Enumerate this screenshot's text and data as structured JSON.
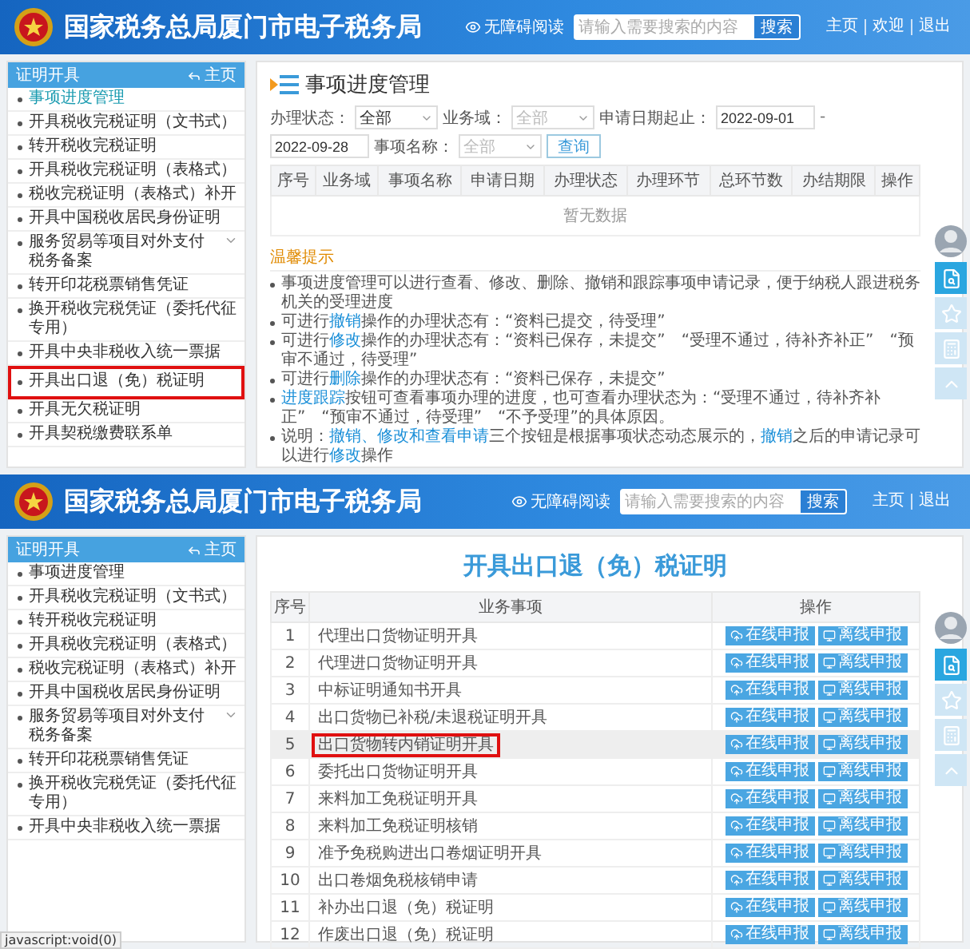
{
  "screens": [
    {
      "kind": "progress",
      "header": {
        "title": "国家税务总局厦门市电子税务局",
        "accessibility": "无障碍阅读",
        "search_placeholder": "请输入需要搜索的内容",
        "search_button": "搜索",
        "links": [
          "主页",
          "欢迎",
          "退出"
        ]
      },
      "sidebar": {
        "title": "证明开具",
        "home": "主页",
        "items": [
          {
            "label": "事项进度管理",
            "selected": true,
            "highlighted": false,
            "expandable": false
          },
          {
            "label": "开具税收完税证明（文书式）",
            "selected": false,
            "highlighted": false,
            "expandable": false
          },
          {
            "label": "转开税收完税证明",
            "selected": false,
            "highlighted": false,
            "expandable": false
          },
          {
            "label": "开具税收完税证明（表格式）",
            "selected": false,
            "highlighted": false,
            "expandable": false
          },
          {
            "label": "税收完税证明（表格式）补开",
            "selected": false,
            "highlighted": false,
            "expandable": false
          },
          {
            "label": "开具中国税收居民身份证明",
            "selected": false,
            "highlighted": false,
            "expandable": false
          },
          {
            "label": "服务贸易等项目对外支付税务备案",
            "selected": false,
            "highlighted": false,
            "expandable": true
          },
          {
            "label": "转开印花税票销售凭证",
            "selected": false,
            "highlighted": false,
            "expandable": false
          },
          {
            "label": "换开税收完税凭证（委托代征专用）",
            "selected": false,
            "highlighted": false,
            "expandable": false
          },
          {
            "label": "开具中央非税收入统一票据",
            "selected": false,
            "highlighted": false,
            "expandable": false
          },
          {
            "label": "开具出口退（免）税证明",
            "selected": false,
            "highlighted": true,
            "expandable": false
          },
          {
            "label": "开具无欠税证明",
            "selected": false,
            "highlighted": false,
            "expandable": false
          },
          {
            "label": "开具契税缴费联系单",
            "selected": false,
            "highlighted": false,
            "expandable": false
          }
        ]
      },
      "page": {
        "title": "事项进度管理",
        "filters": [
          {
            "kind": "select",
            "label": "办理状态：",
            "value": "全部"
          },
          {
            "kind": "select",
            "label": "业务域：",
            "placeholder": "全部"
          },
          {
            "kind": "daterange",
            "label": "申请日期起止：",
            "from": "2022-09-01",
            "separator": "-",
            "to": "2022-09-28"
          },
          {
            "kind": "select",
            "label": "事项名称：",
            "placeholder": "全部"
          }
        ],
        "query_button": "查询",
        "columns": [
          "序号",
          "业务域",
          "事项名称",
          "申请日期",
          "办理状态",
          "办理环节",
          "总环节数",
          "办结期限",
          "操作"
        ],
        "empty_text": "暂无数据",
        "notes_title": "温馨提示",
        "notes": [
          [
            {
              "text": "事项进度管理可以进行查看、修改、删除、撤销和跟踪事项申请记录，便于纳税人跟进税务机关的受理进度",
              "link": false
            }
          ],
          [
            {
              "text": "可进行",
              "link": false
            },
            {
              "text": "撤销",
              "link": true
            },
            {
              "text": "操作的办理状态有：“资料已提交，待受理”",
              "link": false
            }
          ],
          [
            {
              "text": "可进行",
              "link": false
            },
            {
              "text": "修改",
              "link": true
            },
            {
              "text": "操作的办理状态有：“资料已保存，未提交”　“受理不通过，待补齐补正”　“预审不通过，待受理”",
              "link": false
            }
          ],
          [
            {
              "text": "可进行",
              "link": false
            },
            {
              "text": "删除",
              "link": true
            },
            {
              "text": "操作的办理状态有：“资料已保存，未提交”",
              "link": false
            }
          ],
          [
            {
              "text": "进度跟踪",
              "link": true
            },
            {
              "text": "按钮可查看事项办理的进度，也可查看办理状态为：“受理不通过，待补齐补正”　“预审不通过，待受理”　“不予受理”的具体原因。",
              "link": false
            }
          ],
          [
            {
              "text": "说明：",
              "link": false
            },
            {
              "text": "撤销、修改和查看申请",
              "link": true
            },
            {
              "text": "三个按钮是根据事项状态动态展示的，",
              "link": false
            },
            {
              "text": "撤销",
              "link": true
            },
            {
              "text": "之后的申请记录可以进行",
              "link": false
            },
            {
              "text": "修改",
              "link": true
            },
            {
              "text": "操作",
              "link": false
            }
          ]
        ]
      }
    },
    {
      "kind": "certificates",
      "header": {
        "title": "国家税务总局厦门市电子税务局",
        "accessibility": "无障碍阅读",
        "search_placeholder": "请输入需要搜索的内容",
        "search_button": "搜索",
        "links": [
          "主页",
          "退出"
        ]
      },
      "sidebar": {
        "title": "证明开具",
        "home": "主页",
        "items": [
          {
            "label": "事项进度管理",
            "selected": false,
            "highlighted": false,
            "expandable": false
          },
          {
            "label": "开具税收完税证明（文书式）",
            "selected": false,
            "highlighted": false,
            "expandable": false
          },
          {
            "label": "转开税收完税证明",
            "selected": false,
            "highlighted": false,
            "expandable": false
          },
          {
            "label": "开具税收完税证明（表格式）",
            "selected": false,
            "highlighted": false,
            "expandable": false
          },
          {
            "label": "税收完税证明（表格式）补开",
            "selected": false,
            "highlighted": false,
            "expandable": false
          },
          {
            "label": "开具中国税收居民身份证明",
            "selected": false,
            "highlighted": false,
            "expandable": false
          },
          {
            "label": "服务贸易等项目对外支付税务备案",
            "selected": false,
            "highlighted": false,
            "expandable": true
          },
          {
            "label": "转开印花税票销售凭证",
            "selected": false,
            "highlighted": false,
            "expandable": false
          },
          {
            "label": "换开税收完税凭证（委托代征专用）",
            "selected": false,
            "highlighted": false,
            "expandable": false
          },
          {
            "label": "开具中央非税收入统一票据",
            "selected": false,
            "highlighted": false,
            "expandable": false
          }
        ]
      },
      "page": {
        "title": "开具出口退（免）税证明",
        "columns": [
          "序号",
          "业务事项",
          "操作"
        ],
        "rows": [
          {
            "number": "1",
            "name": "代理出口货物证明开具",
            "online": "在线申报",
            "offline": "离线申报",
            "highlighted": false
          },
          {
            "number": "2",
            "name": "代理进口货物证明开具",
            "online": "在线申报",
            "offline": "离线申报",
            "highlighted": false
          },
          {
            "number": "3",
            "name": "中标证明通知书开具",
            "online": "在线申报",
            "offline": "离线申报",
            "highlighted": false
          },
          {
            "number": "4",
            "name": "出口货物已补税/未退税证明开具",
            "online": "在线申报",
            "offline": "离线申报",
            "highlighted": false
          },
          {
            "number": "5",
            "name": "出口货物转内销证明开具",
            "online": "在线申报",
            "offline": "离线申报",
            "highlighted": true
          },
          {
            "number": "6",
            "name": "委托出口货物证明开具",
            "online": "在线申报",
            "offline": "离线申报",
            "highlighted": false
          },
          {
            "number": "7",
            "name": "来料加工免税证明开具",
            "online": "在线申报",
            "offline": "离线申报",
            "highlighted": false
          },
          {
            "number": "8",
            "name": "来料加工免税证明核销",
            "online": "在线申报",
            "offline": "离线申报",
            "highlighted": false
          },
          {
            "number": "9",
            "name": "准予免税购进出口卷烟证明开具",
            "online": "在线申报",
            "offline": "离线申报",
            "highlighted": false
          },
          {
            "number": "10",
            "name": "出口卷烟免税核销申请",
            "online": "在线申报",
            "offline": "离线申报",
            "highlighted": false
          },
          {
            "number": "11",
            "name": "补办出口退（免）税证明",
            "online": "在线申报",
            "offline": "离线申报",
            "highlighted": false
          },
          {
            "number": "12",
            "name": "作废出口退（免）税证明",
            "online": "在线申报",
            "offline": "离线申报",
            "highlighted": false
          }
        ]
      },
      "status_url": "javascript:void(0)"
    }
  ]
}
